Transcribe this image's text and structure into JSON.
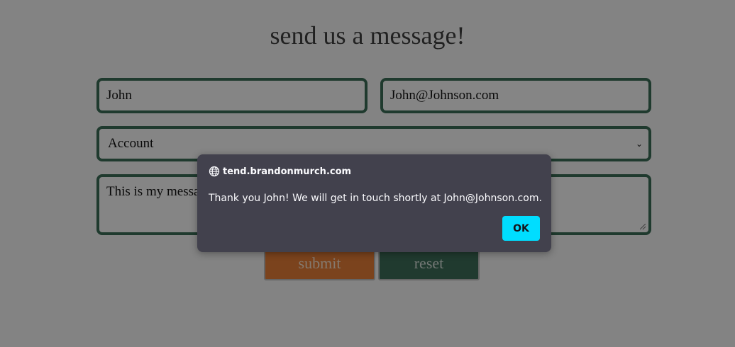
{
  "form": {
    "title": "send us a message!",
    "name_value": "John",
    "email_value": "John@Johnson.com",
    "subject_selected": "Account",
    "message_value": "This is my message",
    "submit_label": "submit",
    "reset_label": "reset"
  },
  "alert": {
    "origin": "tend.brandonmurch.com",
    "message": "Thank you John! We will get in touch shortly at John@Johnson.com.",
    "ok_label": "OK"
  },
  "icons": {
    "origin_icon": "globe-icon",
    "select_icon": "chevron-down-icon"
  },
  "colors": {
    "field_border": "#3a6a55",
    "submit_bg": "#e07a35",
    "reset_bg": "#3b6b56",
    "dialog_bg": "#42414d",
    "ok_bg": "#00ddff"
  }
}
